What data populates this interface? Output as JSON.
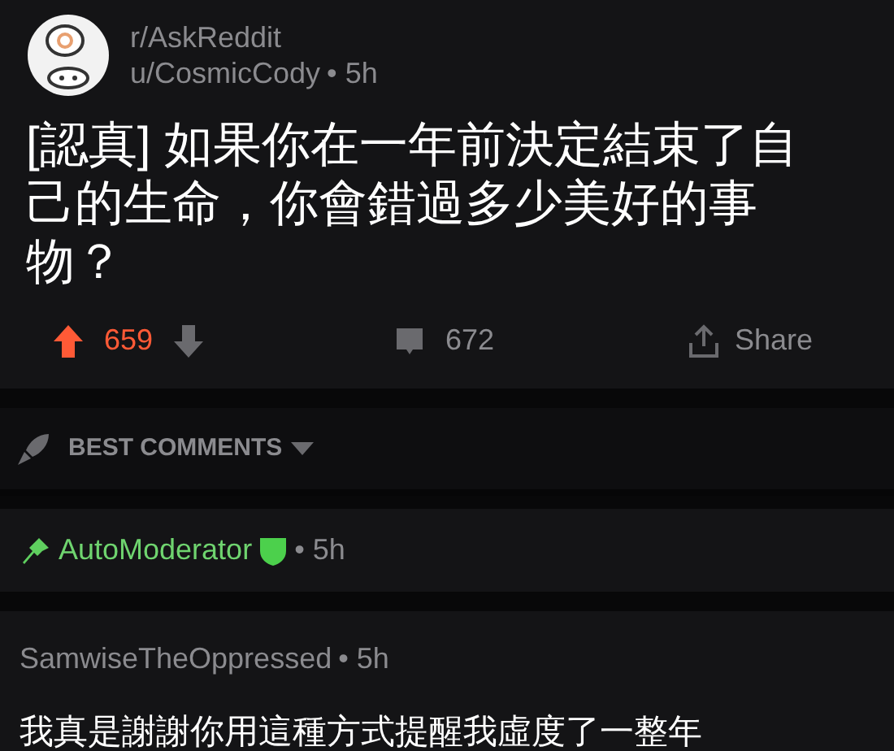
{
  "post": {
    "subreddit": "r/AskReddit",
    "author": "u/CosmicCody",
    "age": "• 5h",
    "title": "[認真] 如果你在一年前決定結束了自己的生命，你會錯過多少美好的事物？",
    "score": "659",
    "upvoted": true,
    "comments": "672",
    "share": "Share"
  },
  "sort": {
    "label": "BEST COMMENTS"
  },
  "comments": [
    {
      "kind": "moderator",
      "author": "AutoModerator",
      "age": "• 5h"
    },
    {
      "kind": "user",
      "author": "SamwiseTheOppressed",
      "age": "• 5h",
      "body": "我真是謝謝你用這種方式提醒我虛度了一整年"
    }
  ]
}
